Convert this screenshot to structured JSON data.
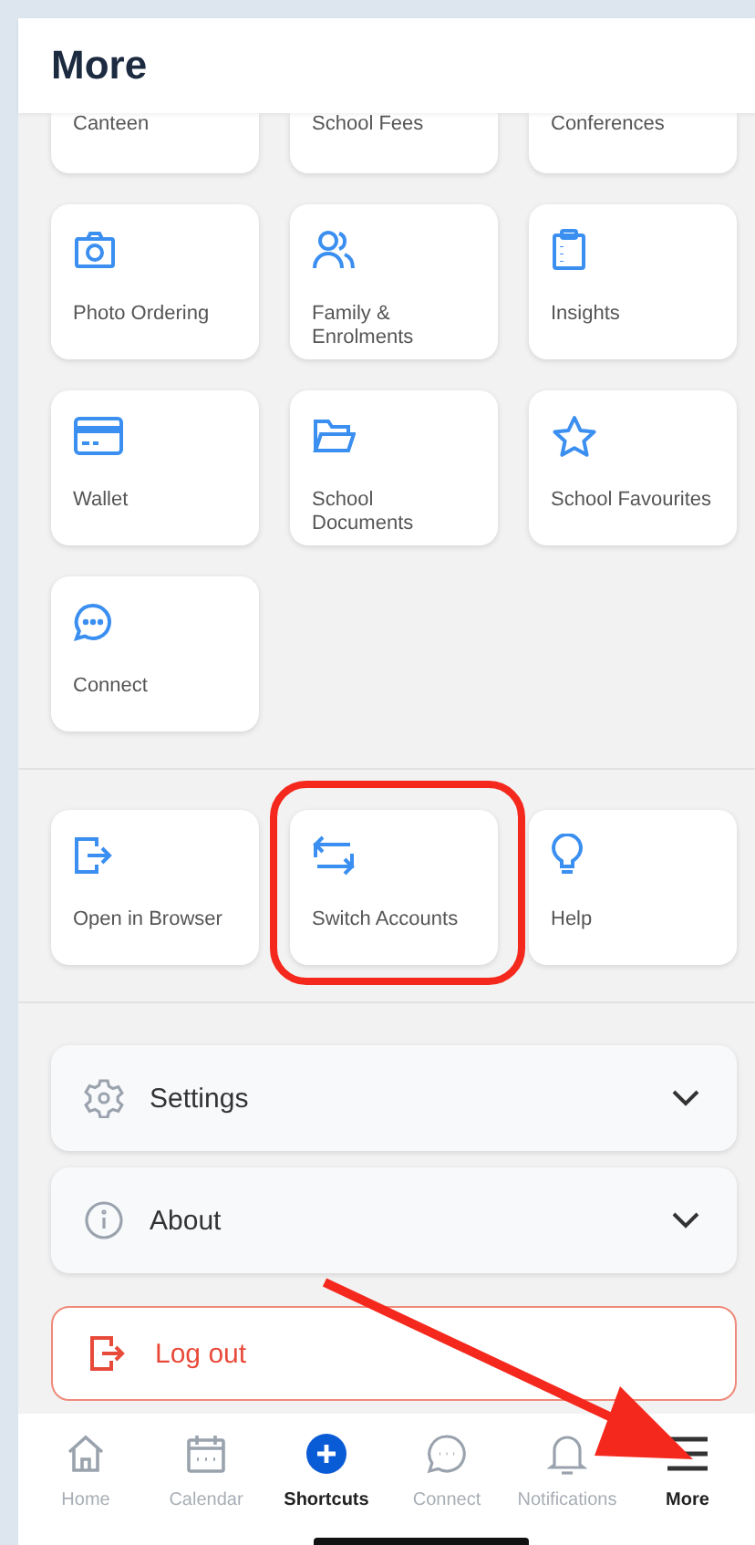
{
  "header": {
    "title": "More"
  },
  "shortcuts": [
    {
      "label": "Canteen",
      "clipped": true
    },
    {
      "label": "School Fees",
      "clipped": true
    },
    {
      "label": "Conferences",
      "clipped": true
    },
    {
      "label": "Photo Ordering",
      "clipped": false
    },
    {
      "label": "Family & Enrolments",
      "clipped": false
    },
    {
      "label": "Insights",
      "clipped": false
    },
    {
      "label": "Wallet",
      "clipped": false
    },
    {
      "label": "School Documents",
      "clipped": false
    },
    {
      "label": "School Favourites",
      "clipped": false
    },
    {
      "label": "Connect",
      "clipped": false
    }
  ],
  "actions": [
    {
      "label": "Open in Browser",
      "highlighted": false
    },
    {
      "label": "Switch Accounts",
      "highlighted": true
    },
    {
      "label": "Help",
      "highlighted": false
    }
  ],
  "sections": [
    {
      "label": "Settings",
      "expanded": false
    },
    {
      "label": "About",
      "expanded": false
    }
  ],
  "logout": {
    "label": "Log out"
  },
  "tabs": [
    {
      "label": "Home",
      "kind": "plain",
      "pointed_at": false
    },
    {
      "label": "Calendar",
      "kind": "plain",
      "pointed_at": false
    },
    {
      "label": "Shortcuts",
      "kind": "feature",
      "pointed_at": false
    },
    {
      "label": "Connect",
      "kind": "plain",
      "pointed_at": false
    },
    {
      "label": "Notifications",
      "kind": "plain",
      "pointed_at": false
    },
    {
      "label": "More",
      "kind": "current",
      "pointed_at": true
    }
  ]
}
